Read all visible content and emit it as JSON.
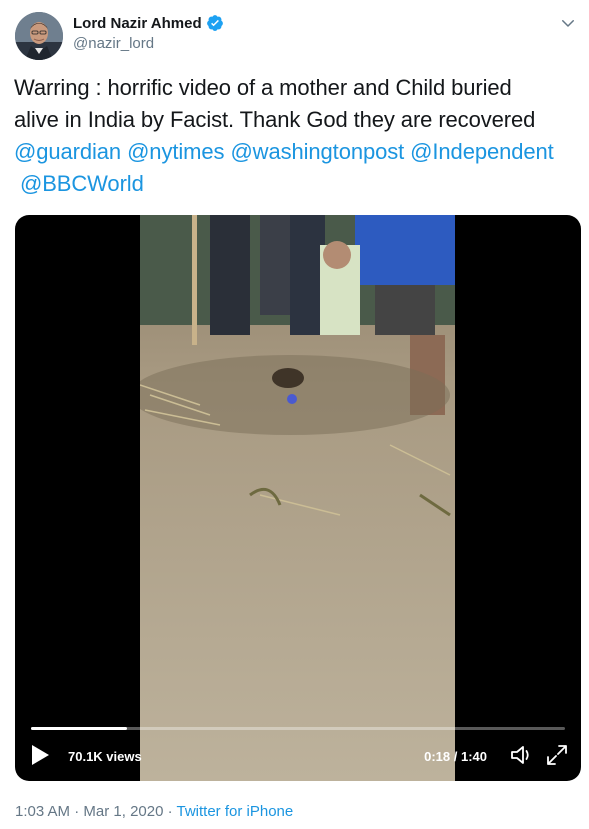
{
  "author": {
    "display_name": "Lord Nazir Ahmed",
    "handle": "@nazir_lord",
    "verified": true
  },
  "icons": {
    "verified": "verified-badge-icon",
    "menu": "chevron-down-icon",
    "play": "play-icon",
    "volume": "volume-icon",
    "fullscreen": "fullscreen-icon"
  },
  "tweet": {
    "text_line1": "Warring : horrific video of a mother and Child buried",
    "text_line2": "alive in India by Facist. Thank God they are recovered",
    "mentions": [
      "@guardian",
      "@nytimes",
      "@washingtonpost",
      "@Independent",
      "@BBCWorld"
    ]
  },
  "video": {
    "views": "70.1K views",
    "time": "0:18 / 1:40",
    "progress_fraction": 0.18
  },
  "meta": {
    "time": "1:03 AM",
    "separator1": " · ",
    "date": "Mar 1, 2020",
    "separator2": " · ",
    "source": "Twitter for iPhone"
  },
  "colors": {
    "link": "#1b95e0",
    "text": "#14171a",
    "muted": "#657786",
    "verified": "#1da1f2"
  }
}
